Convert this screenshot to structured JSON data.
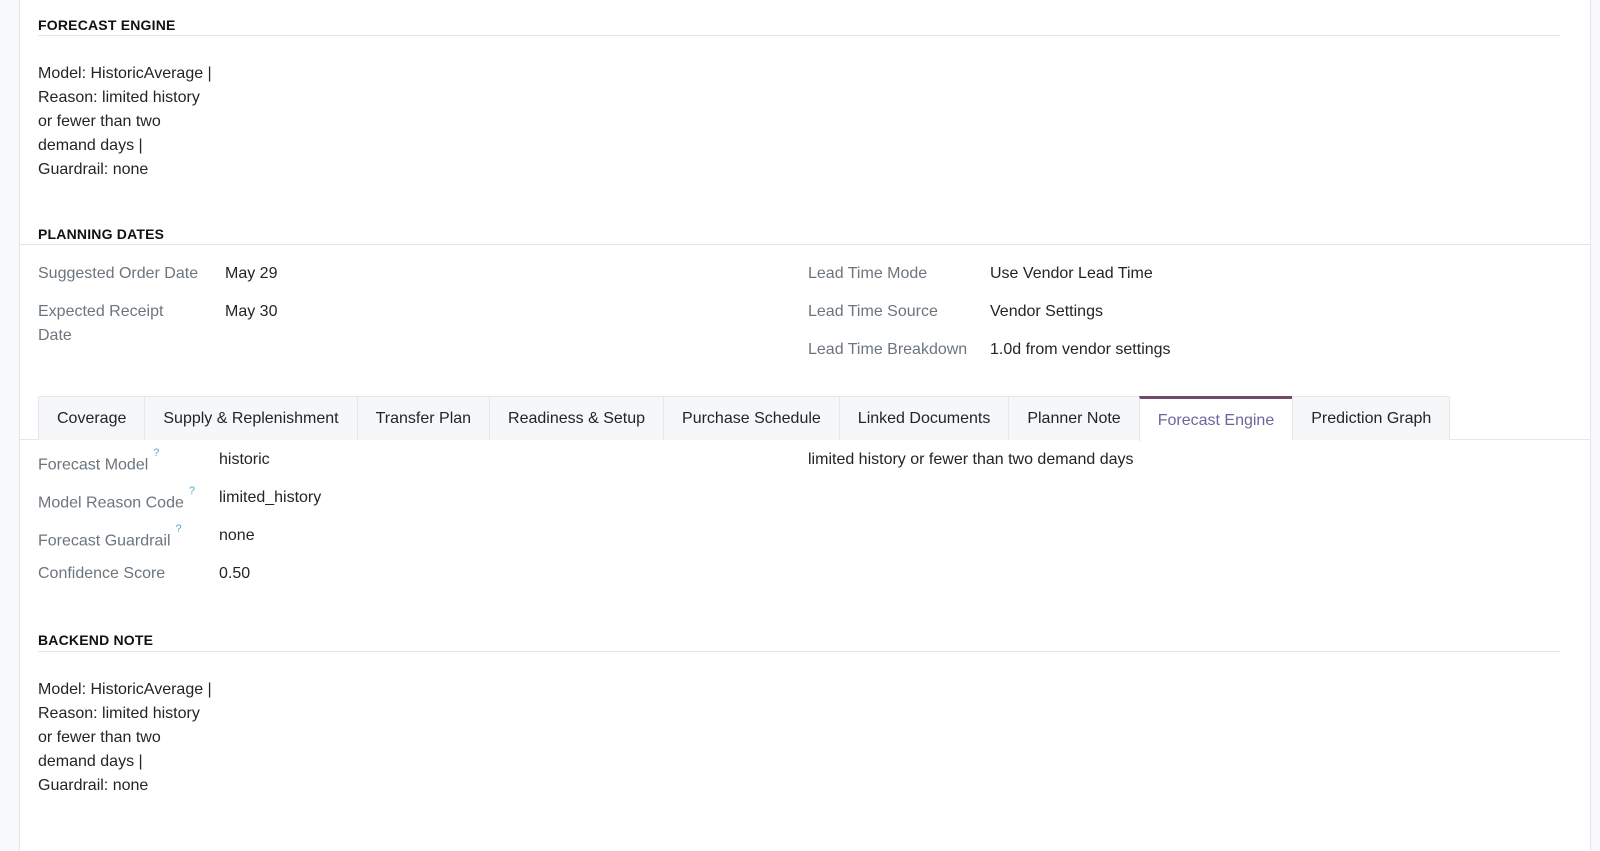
{
  "forecast_engine_section": {
    "title": "FORECAST ENGINE",
    "note": "Model: HistoricAverage | Reason: limited history or fewer than two demand days | Guardrail: none"
  },
  "planning_dates": {
    "title": "PLANNING DATES",
    "suggested_order_date_label": "Suggested Order Date",
    "suggested_order_date_value": "May 29",
    "expected_receipt_date_label": "Expected Receipt Date",
    "expected_receipt_date_value": "May 30",
    "lead_time_mode_label": "Lead Time Mode",
    "lead_time_mode_value": "Use Vendor Lead Time",
    "lead_time_source_label": "Lead Time Source",
    "lead_time_source_value": "Vendor Settings",
    "lead_time_breakdown_label": "Lead Time Breakdown",
    "lead_time_breakdown_value": "1.0d from vendor settings"
  },
  "tabs": [
    {
      "label": "Coverage"
    },
    {
      "label": "Supply & Replenishment"
    },
    {
      "label": "Transfer Plan"
    },
    {
      "label": "Readiness & Setup"
    },
    {
      "label": "Purchase Schedule"
    },
    {
      "label": "Linked Documents"
    },
    {
      "label": "Planner Note"
    },
    {
      "label": "Forecast Engine"
    },
    {
      "label": "Prediction Graph"
    }
  ],
  "active_tab": "Forecast Engine",
  "forecast_tab": {
    "forecast_model_label": "Forecast Model",
    "forecast_model_value": "historic",
    "model_reason_code_label": "Model Reason Code",
    "model_reason_code_value": "limited_history",
    "forecast_guardrail_label": "Forecast Guardrail",
    "forecast_guardrail_value": "none",
    "confidence_score_label": "Confidence Score",
    "confidence_score_value": "0.50",
    "reason_description": "limited history or fewer than two demand days",
    "help_marker": "?"
  },
  "backend_note_section": {
    "title": "BACKEND NOTE",
    "note": "Model: HistoricAverage | Reason: limited history or fewer than two demand days | Guardrail: none"
  },
  "colors": {
    "active_tab_accent": "#714b67",
    "active_tab_text": "#71639e",
    "help_marker": "#5aa9c9",
    "label_text": "#6c757d"
  }
}
